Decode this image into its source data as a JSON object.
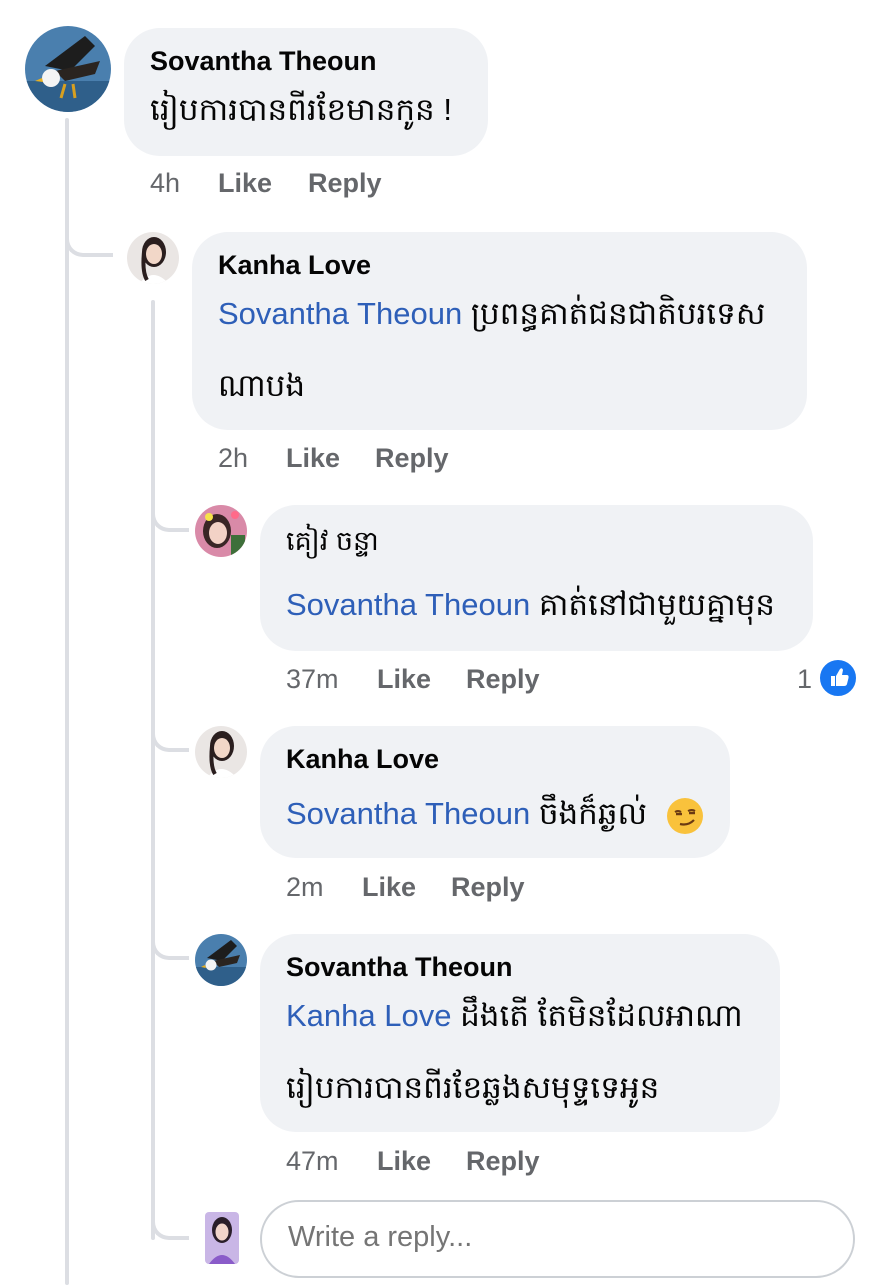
{
  "comments": [
    {
      "author": "Sovantha Theoun",
      "text": "រៀបការបានពីរខែមានកូន !",
      "time": "4h",
      "like": "Like",
      "reply": "Reply"
    },
    {
      "author": "Kanha Love",
      "mention": "Sovantha Theoun",
      "text_line1": "ប្រពន្ធគាត់ជនជាតិបរទេស",
      "text_line2": "ណាបង",
      "time": "2h",
      "like": "Like",
      "reply": "Reply"
    },
    {
      "author": "គៀវ ចន្ទា",
      "mention": "Sovantha Theoun",
      "text": "គាត់នៅជាមួយគ្នាមុន",
      "time": "37m",
      "like": "Like",
      "reply": "Reply",
      "reaction_count": "1",
      "reaction_icon": "thumbs-up-icon"
    },
    {
      "author": "Kanha Love",
      "mention": "Sovantha Theoun",
      "text": "ចឹងក៏ឆ្ងល់",
      "emoji": "smirk-emoji",
      "time": "2m",
      "like": "Like",
      "reply": "Reply"
    },
    {
      "author": "Sovantha Theoun",
      "mention": "Kanha Love",
      "text_line1": "ដឹងតើ តែមិនដែលអាណា",
      "text_line2": "រៀបការបានពីរខែឆ្លងសមុទ្ទទេអូន",
      "time": "47m",
      "like": "Like",
      "reply": "Reply"
    }
  ],
  "reply_box": {
    "placeholder": "Write a reply..."
  },
  "colors": {
    "bubble": "#f0f2f5",
    "mention": "#2e5fb8",
    "meta": "#65676b",
    "like_blue": "#1877f2"
  }
}
